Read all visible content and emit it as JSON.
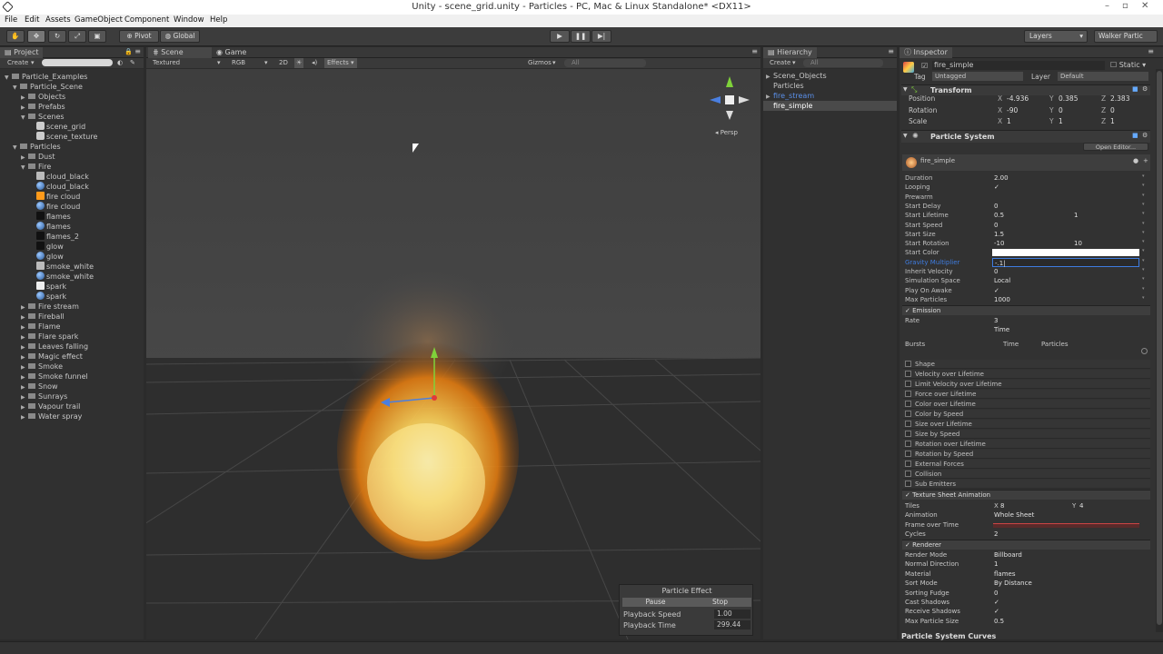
{
  "window": {
    "title": "Unity - scene_grid.unity - Particles - PC, Mac & Linux Standalone* <DX11>"
  },
  "menu": [
    "File",
    "Edit",
    "Assets",
    "GameObject",
    "Component",
    "Window",
    "Help"
  ],
  "toolbar": {
    "pivot": "Pivot",
    "global": "Global",
    "layers": "Layers",
    "layout": "Walker Partic"
  },
  "project": {
    "tab": "Project",
    "create": "Create",
    "rows": [
      {
        "label": "Particle_Examples",
        "depth": 0,
        "kind": "folder",
        "open": true
      },
      {
        "label": "Particle_Scene",
        "depth": 1,
        "kind": "folder",
        "open": true
      },
      {
        "label": "Objects",
        "depth": 2,
        "kind": "folder",
        "open": false
      },
      {
        "label": "Prefabs",
        "depth": 2,
        "kind": "folder",
        "open": false
      },
      {
        "label": "Scenes",
        "depth": 2,
        "kind": "folder",
        "open": true
      },
      {
        "label": "scene_grid",
        "depth": 3,
        "kind": "scene"
      },
      {
        "label": "scene_texture",
        "depth": 3,
        "kind": "scene"
      },
      {
        "label": "Particles",
        "depth": 1,
        "kind": "folder",
        "open": true
      },
      {
        "label": "Dust",
        "depth": 2,
        "kind": "folder",
        "open": false
      },
      {
        "label": "Fire",
        "depth": 2,
        "kind": "folder",
        "open": true
      },
      {
        "label": "cloud_black",
        "depth": 3,
        "kind": "texture"
      },
      {
        "label": "cloud_black",
        "depth": 3,
        "kind": "material"
      },
      {
        "label": "fire cloud",
        "depth": 3,
        "kind": "texture-fire"
      },
      {
        "label": "fire cloud",
        "depth": 3,
        "kind": "material"
      },
      {
        "label": "flames",
        "depth": 3,
        "kind": "dark"
      },
      {
        "label": "flames",
        "depth": 3,
        "kind": "material"
      },
      {
        "label": "flames_2",
        "depth": 3,
        "kind": "dark"
      },
      {
        "label": "glow",
        "depth": 3,
        "kind": "dark"
      },
      {
        "label": "glow",
        "depth": 3,
        "kind": "material"
      },
      {
        "label": "smoke_white",
        "depth": 3,
        "kind": "texture"
      },
      {
        "label": "smoke_white",
        "depth": 3,
        "kind": "material"
      },
      {
        "label": "spark",
        "depth": 3,
        "kind": "white"
      },
      {
        "label": "spark",
        "depth": 3,
        "kind": "material"
      },
      {
        "label": "Fire stream",
        "depth": 2,
        "kind": "folder",
        "open": false
      },
      {
        "label": "Fireball",
        "depth": 2,
        "kind": "folder",
        "open": false
      },
      {
        "label": "Flame",
        "depth": 2,
        "kind": "folder",
        "open": false
      },
      {
        "label": "Flare spark",
        "depth": 2,
        "kind": "folder",
        "open": false
      },
      {
        "label": "Leaves falling",
        "depth": 2,
        "kind": "folder",
        "open": false
      },
      {
        "label": "Magic effect",
        "depth": 2,
        "kind": "folder",
        "open": false
      },
      {
        "label": "Smoke",
        "depth": 2,
        "kind": "folder",
        "open": false
      },
      {
        "label": "Smoke funnel",
        "depth": 2,
        "kind": "folder",
        "open": false
      },
      {
        "label": "Snow",
        "depth": 2,
        "kind": "folder",
        "open": false
      },
      {
        "label": "Sunrays",
        "depth": 2,
        "kind": "folder",
        "open": false
      },
      {
        "label": "Vapour trail",
        "depth": 2,
        "kind": "folder",
        "open": false
      },
      {
        "label": "Water spray",
        "depth": 2,
        "kind": "folder",
        "open": false
      }
    ]
  },
  "scene": {
    "tabs": [
      "Scene",
      "Game"
    ],
    "shading": "Textured",
    "rgb": "RGB",
    "mode2d": "2D",
    "effects": "Effects",
    "gizmos": "Gizmos",
    "search_placeholder": "All",
    "persp": "Persp",
    "particle_effect": {
      "title": "Particle Effect",
      "pause": "Pause",
      "stop": "Stop",
      "speed_label": "Playback Speed",
      "speed_value": "1.00",
      "time_label": "Playback Time",
      "time_value": "299.44"
    }
  },
  "hierarchy": {
    "tab": "Hierarchy",
    "create": "Create",
    "search_placeholder": "All",
    "rows": [
      {
        "label": "Scene_Objects",
        "depth": 0,
        "style": "normal",
        "arrow": true
      },
      {
        "label": "Particles",
        "depth": 0,
        "style": "normal",
        "arrow": false
      },
      {
        "label": "fire_stream",
        "depth": 0,
        "style": "prefab",
        "arrow": true
      },
      {
        "label": "fire_simple",
        "depth": 0,
        "style": "selected",
        "arrow": false
      }
    ]
  },
  "inspector": {
    "tab": "Inspector",
    "object_name": "fire_simple",
    "static": "Static",
    "tag_label": "Tag",
    "tag_value": "Untagged",
    "layer_label": "Layer",
    "layer_value": "Default",
    "transform": {
      "title": "Transform",
      "rows": [
        {
          "label": "Position",
          "x": "-4.936",
          "y": "0.385",
          "z": "2.383"
        },
        {
          "label": "Rotation",
          "x": "-90",
          "y": "0",
          "z": "0"
        },
        {
          "label": "Scale",
          "x": "1",
          "y": "1",
          "z": "1"
        }
      ]
    },
    "particle_system": {
      "title": "Particle System",
      "open_editor": "Open Editor...",
      "name": "fire_simple",
      "props": [
        {
          "label": "Duration",
          "value": "2.00",
          "value2": ""
        },
        {
          "label": "Looping",
          "value": "✓",
          "value2": ""
        },
        {
          "label": "Prewarm",
          "value": "",
          "value2": ""
        },
        {
          "label": "Start Delay",
          "value": "0",
          "value2": ""
        },
        {
          "label": "Start Lifetime",
          "value": "0.5",
          "value2": "1"
        },
        {
          "label": "Start Speed",
          "value": "0",
          "value2": ""
        },
        {
          "label": "Start Size",
          "value": "1.5",
          "value2": ""
        },
        {
          "label": "Start Rotation",
          "value": "-10",
          "value2": "10"
        },
        {
          "label": "Start Color",
          "value": "",
          "value2": ""
        },
        {
          "label": "Gravity Multiplier",
          "value": "-.1|",
          "value2": ""
        },
        {
          "label": "Inherit Velocity",
          "value": "0",
          "value2": ""
        },
        {
          "label": "Simulation Space",
          "value": "Local",
          "value2": ""
        },
        {
          "label": "Play On Awake",
          "value": "✓",
          "value2": ""
        },
        {
          "label": "Max Particles",
          "value": "1000",
          "value2": ""
        }
      ],
      "emission": {
        "title": "Emission",
        "rate_label": "Rate",
        "rate_value": "3",
        "rate_mode": "Time",
        "bursts_label": "Bursts",
        "bursts_time": "Time",
        "bursts_particles": "Particles"
      },
      "modules": [
        "Shape",
        "Velocity over Lifetime",
        "Limit Velocity over Lifetime",
        "Force over Lifetime",
        "Color over Lifetime",
        "Color by Speed",
        "Size over Lifetime",
        "Size by Speed",
        "Rotation over Lifetime",
        "Rotation by Speed",
        "External Forces",
        "Collision",
        "Sub Emitters"
      ],
      "texture_sheet": {
        "title": "Texture Sheet Animation",
        "tiles_label": "Tiles",
        "tiles_x_label": "X",
        "tiles_x": "8",
        "tiles_y_label": "Y",
        "tiles_y": "4",
        "animation_label": "Animation",
        "animation_value": "Whole Sheet",
        "frame_label": "Frame over Time",
        "cycles_label": "Cycles",
        "cycles_value": "2"
      },
      "renderer": {
        "title": "Renderer",
        "rows": [
          {
            "label": "Render Mode",
            "value": "Billboard"
          },
          {
            "label": "Normal Direction",
            "value": "1"
          },
          {
            "label": "Material",
            "value": "flames"
          },
          {
            "label": "Sort Mode",
            "value": "By Distance"
          },
          {
            "label": "Sorting Fudge",
            "value": "0"
          },
          {
            "label": "Cast Shadows",
            "value": "✓"
          },
          {
            "label": "Receive Shadows",
            "value": "✓"
          },
          {
            "label": "Max Particle Size",
            "value": "0.5"
          }
        ]
      },
      "curves_title": "Particle System Curves"
    }
  },
  "colors": {
    "accent": "#3e7ce0",
    "selected": "#3d5f8f",
    "prefab": "#5a8fe8",
    "fire": "#ffb020"
  }
}
